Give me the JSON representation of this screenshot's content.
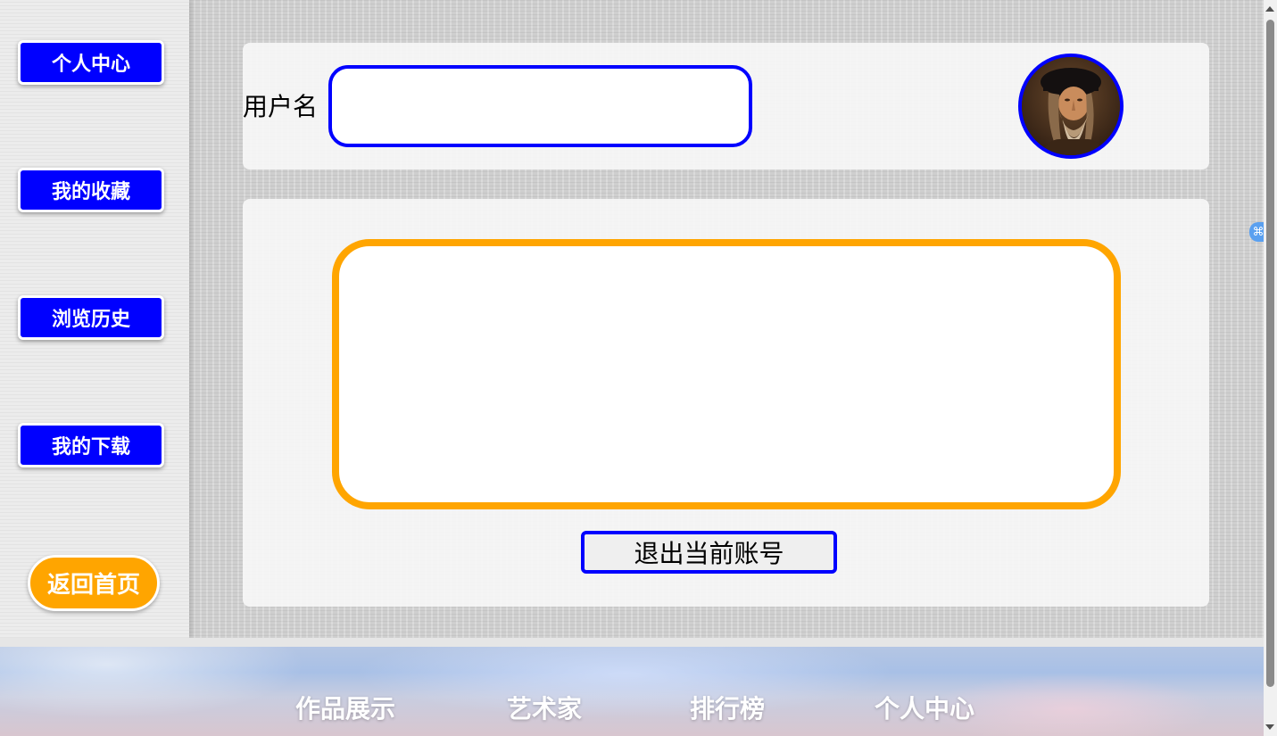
{
  "sidebar": {
    "items": [
      {
        "label": "个人中心"
      },
      {
        "label": "我的收藏"
      },
      {
        "label": "浏览历史"
      },
      {
        "label": "我的下载"
      }
    ],
    "home_label": "返回首页"
  },
  "profile": {
    "username_label": "用户名",
    "username_value": "",
    "bio_value": "",
    "logout_label": "退出当前账号"
  },
  "footer": {
    "nav": [
      {
        "label": "作品展示"
      },
      {
        "label": "艺术家"
      },
      {
        "label": "排行榜"
      },
      {
        "label": "个人中心"
      }
    ]
  },
  "colors": {
    "primary": "#0000ff",
    "accent": "#ffa500",
    "text_light": "#ffffff"
  },
  "icons": {
    "avatar": "portrait-avatar",
    "extension": "command-icon"
  }
}
